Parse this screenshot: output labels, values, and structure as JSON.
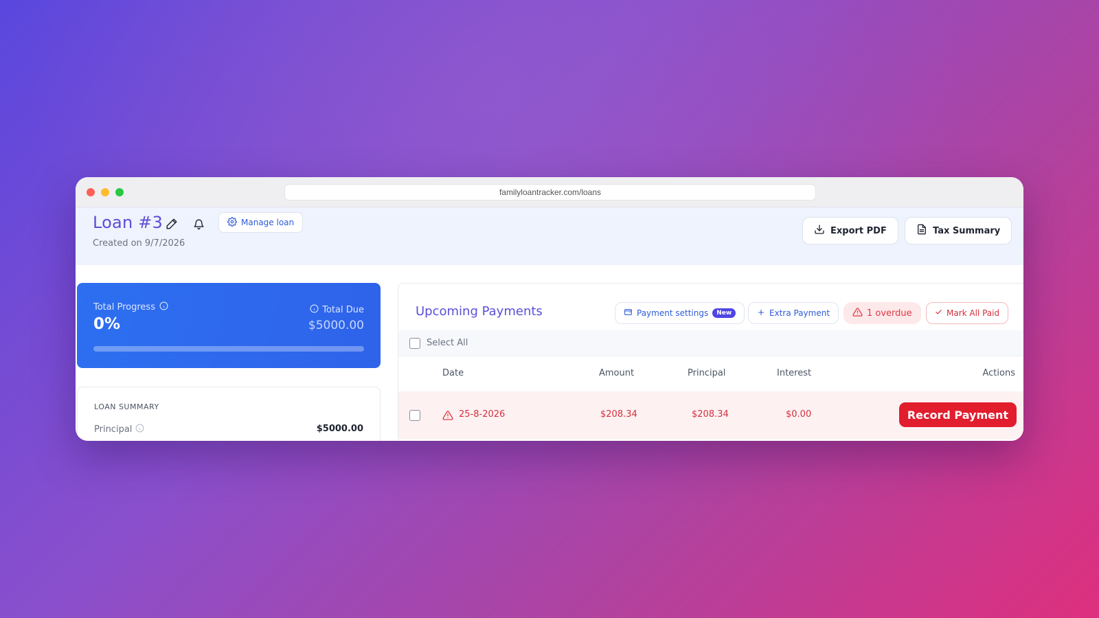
{
  "browser": {
    "url": "familyloantracker.com/loans"
  },
  "header": {
    "title": "Loan #3",
    "created": "Created on 9/7/2026",
    "manage_label": "Manage loan",
    "export_label": "Export PDF",
    "tax_label": "Tax Summary"
  },
  "progress": {
    "label": "Total Progress",
    "value_text": "0%",
    "fraction": 0,
    "due_label": "Total Due",
    "due_value": "$5000.00"
  },
  "summary": {
    "title": "LOAN SUMMARY",
    "principal_label": "Principal",
    "principal_value": "$5000.00"
  },
  "payments": {
    "title": "Upcoming Payments",
    "settings_label": "Payment settings",
    "new_badge": "New",
    "extra_label": "Extra Payment",
    "overdue_label": "1 overdue",
    "mark_all_label": "Mark All Paid",
    "select_all_label": "Select All",
    "columns": {
      "date": "Date",
      "amount": "Amount",
      "principal": "Principal",
      "interest": "Interest",
      "actions": "Actions"
    },
    "rows": [
      {
        "date": "25-8-2026",
        "amount": "$208.34",
        "principal": "$208.34",
        "interest": "$0.00",
        "action_label": "Record Payment",
        "status": "overdue"
      }
    ]
  },
  "colors": {
    "accent_purple": "#5b4fd6",
    "accent_blue": "#2f5bd8",
    "danger_red": "#e11d2e"
  }
}
